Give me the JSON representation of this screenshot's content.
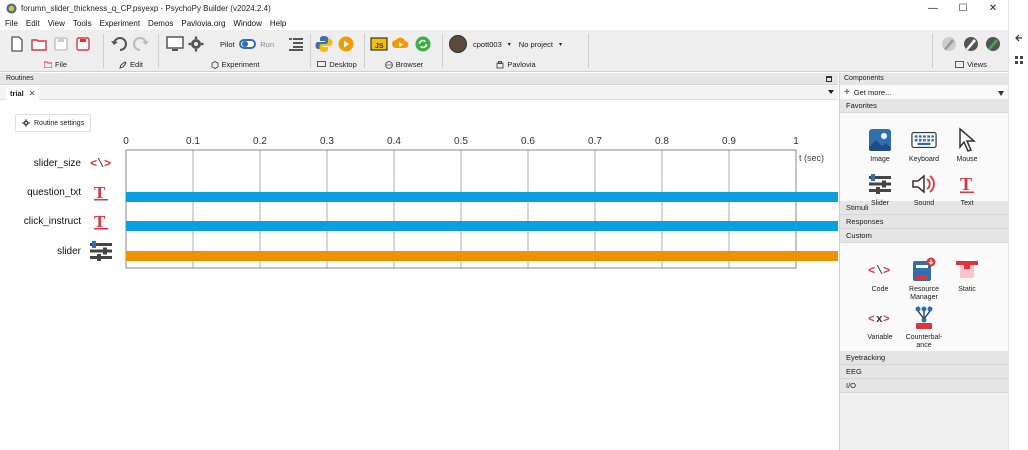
{
  "window": {
    "title": "forumn_slider_thickness_q_CP.psyexp - PsychoPy Builder (v2024.2.4)",
    "minimize": "—",
    "maximize": "☐",
    "close": "✕"
  },
  "menu": [
    "File",
    "Edit",
    "View",
    "Tools",
    "Experiment",
    "Demos",
    "Pavlovia.org",
    "Window",
    "Help"
  ],
  "toolbar": {
    "file_label": "File",
    "edit_label": "Edit",
    "experiment_label": "Experiment",
    "desktop_label": "Desktop",
    "browser_label": "Browser",
    "pavlovia_label": "Pavlovia",
    "views_label": "Views",
    "pilot_label": "Pilot",
    "run_label": "Run",
    "user": "cpott003",
    "project": "No project"
  },
  "routines": {
    "header": "Routines",
    "tab": "trial",
    "tab_close": "✕",
    "routine_settings": "Routine settings"
  },
  "timeline": {
    "ticks": [
      "0",
      "0.1",
      "0.2",
      "0.3",
      "0.4",
      "0.5",
      "0.6",
      "0.7",
      "0.8",
      "0.9",
      "1"
    ],
    "axis_label": "t (sec)",
    "components": [
      {
        "name": "slider_size",
        "icon": "code-icon"
      },
      {
        "name": "question_txt",
        "icon": "text-icon",
        "bar_color": "#0aa0e0"
      },
      {
        "name": "click_instruct",
        "icon": "text-icon",
        "bar_color": "#0aa0e0"
      },
      {
        "name": "slider",
        "icon": "slider-icon",
        "bar_color": "#ef9100"
      }
    ]
  },
  "components_panel": {
    "header": "Components",
    "get_more": "Get more...",
    "favorites": "Favorites",
    "favorites_items": [
      "Image",
      "Keyboard",
      "Mouse",
      "Slider",
      "Sound",
      "Text"
    ],
    "stimuli": "Stimuli",
    "responses": "Responses",
    "custom": "Custom",
    "custom_items": [
      "Code",
      "Resource Manager",
      "Static",
      "Variable",
      "Counterbal-ance"
    ],
    "eyetracking": "Eyetracking",
    "eeg": "EEG",
    "io": "I/O"
  },
  "colors": {
    "accent_blue": "#0aa0e0",
    "accent_orange": "#ef9100",
    "text_red": "#e0333b"
  }
}
